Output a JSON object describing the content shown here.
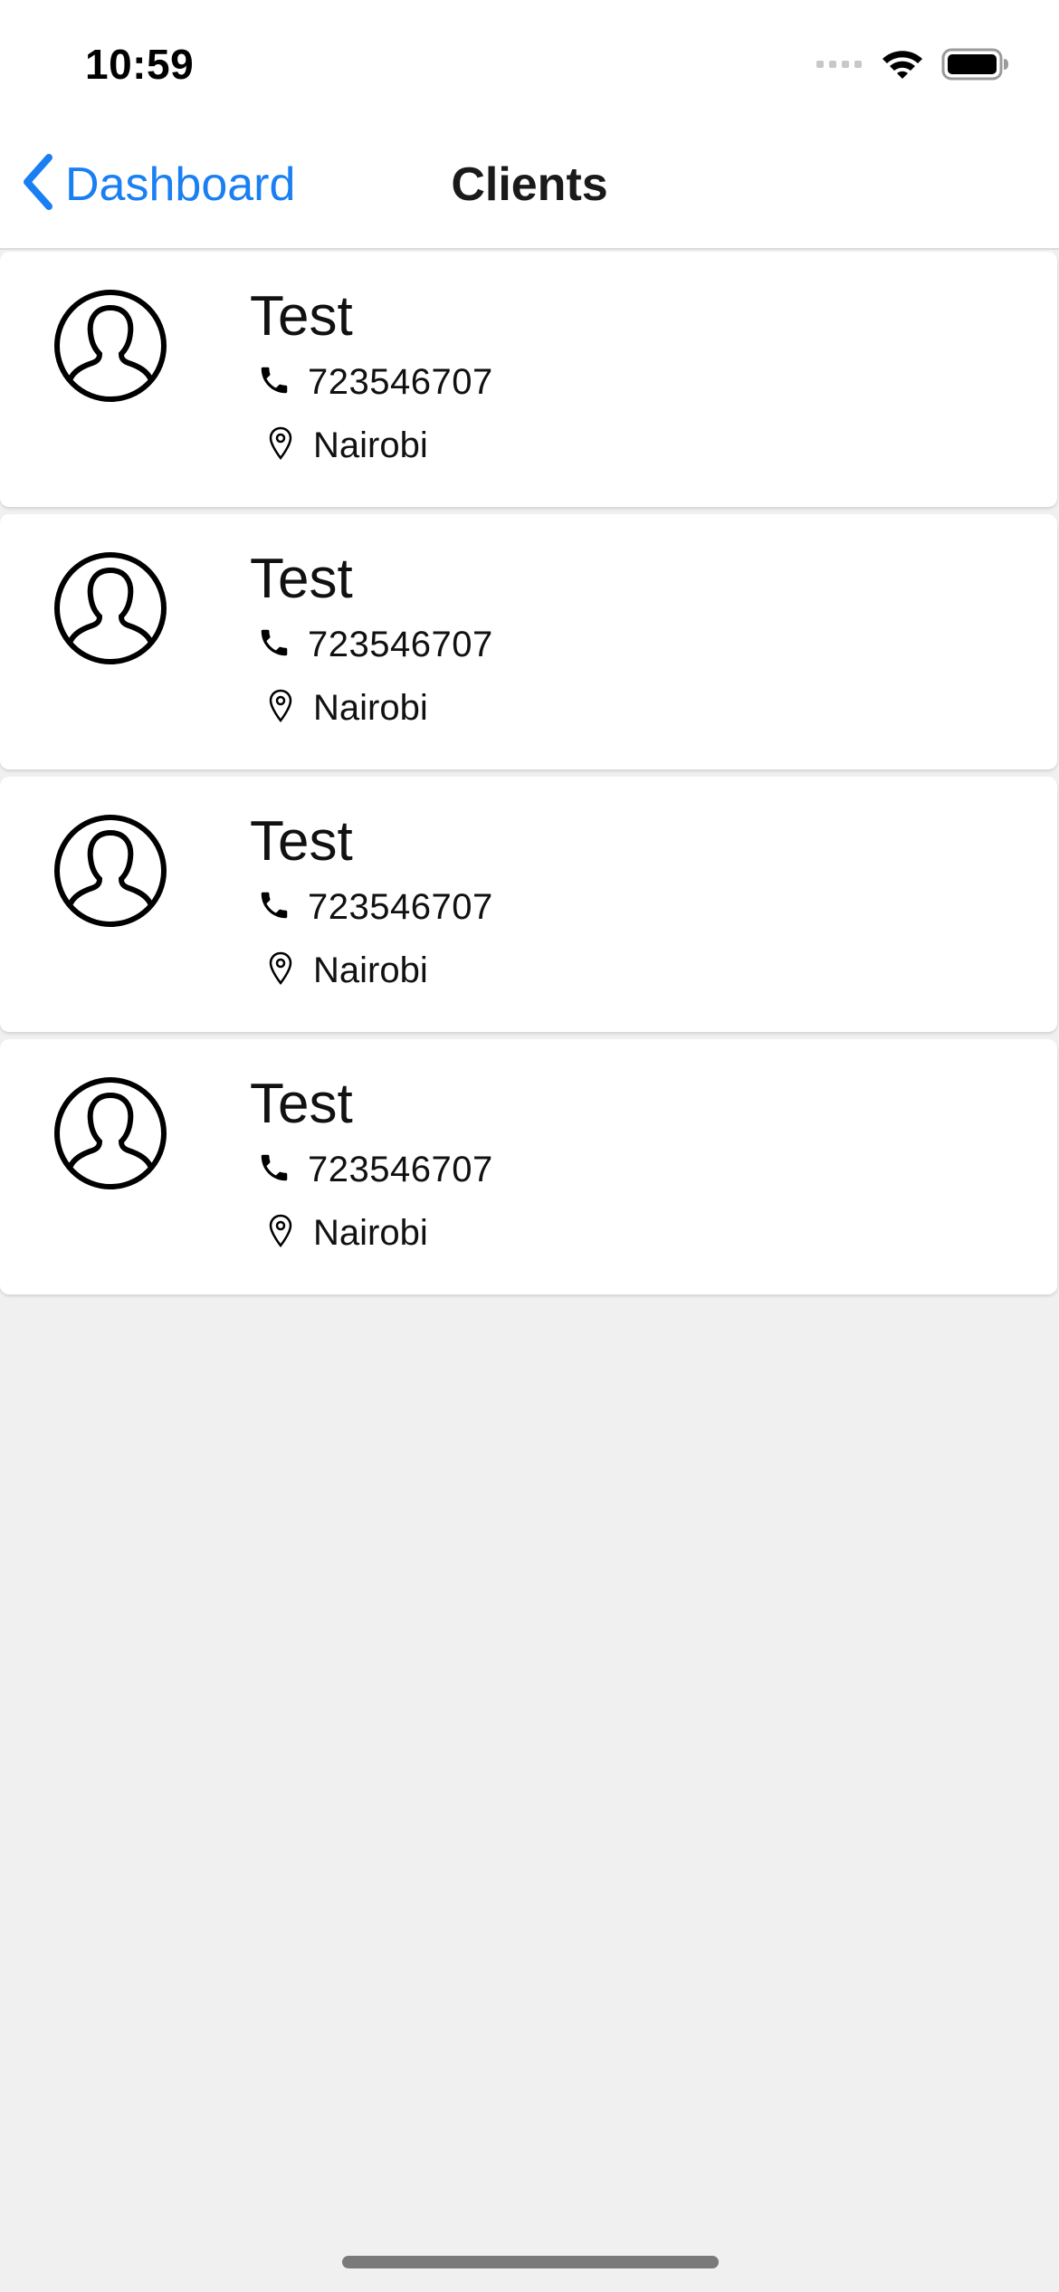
{
  "status_bar": {
    "time": "10:59",
    "icons": [
      "signal-icon",
      "wifi-icon",
      "battery-icon"
    ]
  },
  "nav": {
    "back_label": "Dashboard",
    "title": "Clients",
    "back_icon": "chevron-left-icon",
    "accent_color": "#1a7ff2"
  },
  "clients": [
    {
      "name": "Test",
      "phone": "723546707",
      "location": "Nairobi",
      "avatar_icon": "user-avatar-icon",
      "phone_icon": "phone-icon",
      "location_icon": "location-pin-icon"
    },
    {
      "name": "Test",
      "phone": "723546707",
      "location": "Nairobi",
      "avatar_icon": "user-avatar-icon",
      "phone_icon": "phone-icon",
      "location_icon": "location-pin-icon"
    },
    {
      "name": "Test",
      "phone": "723546707",
      "location": "Nairobi",
      "avatar_icon": "user-avatar-icon",
      "phone_icon": "phone-icon",
      "location_icon": "location-pin-icon"
    },
    {
      "name": "Test",
      "phone": "723546707",
      "location": "Nairobi",
      "avatar_icon": "user-avatar-icon",
      "phone_icon": "phone-icon",
      "location_icon": "location-pin-icon"
    }
  ]
}
